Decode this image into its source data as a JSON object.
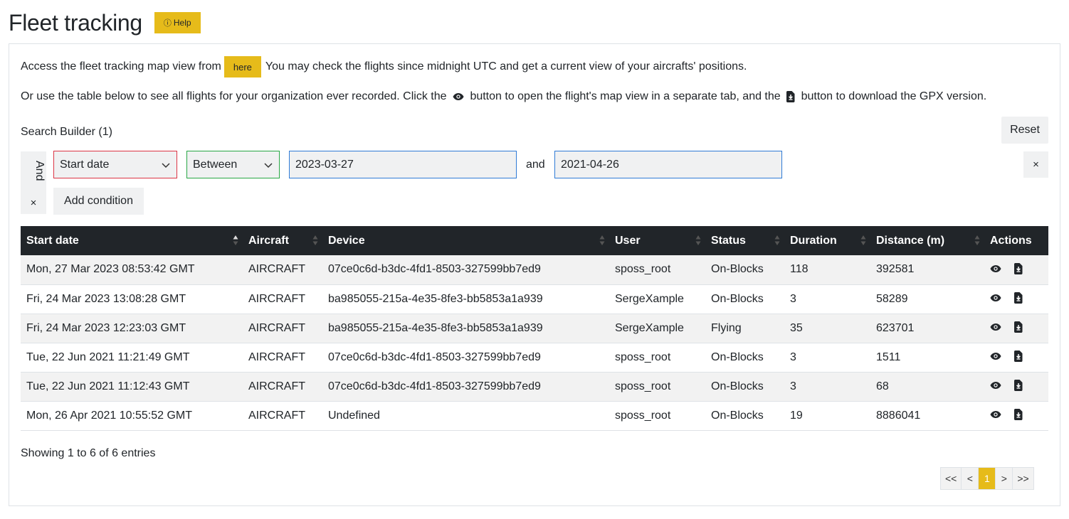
{
  "header": {
    "title": "Fleet tracking",
    "help_label": "Help"
  },
  "intro": {
    "line1_before": "Access the fleet tracking map view from",
    "here_label": "here",
    "line1_after": "You may check the flights since midnight UTC and get a current view of your aircrafts' positions.",
    "line2_a": "Or use the table below to see all flights for your organization ever recorded. Click the",
    "line2_b": "button to open the flight's map view in a separate tab, and the",
    "line2_c": "button to download the GPX version."
  },
  "search_builder": {
    "title": "Search Builder (1)",
    "reset_label": "Reset",
    "logic": "And",
    "remove_glyph": "×",
    "field": "Start date",
    "condition": "Between",
    "value1": "2023-03-27",
    "joiner": "and",
    "value2": "2021-04-26",
    "add_condition_label": "Add condition"
  },
  "table": {
    "columns": [
      "Start date",
      "Aircraft",
      "Device",
      "User",
      "Status",
      "Duration",
      "Distance (m)",
      "Actions"
    ],
    "rows": [
      {
        "start_date": "Mon, 27 Mar 2023 08:53:42 GMT",
        "aircraft": "AIRCRAFT",
        "device": "07ce0c6d-b3dc-4fd1-8503-327599bb7ed9",
        "user": "sposs_root",
        "status": "On-Blocks",
        "duration": "118",
        "distance": "392581"
      },
      {
        "start_date": "Fri, 24 Mar 2023 13:08:28 GMT",
        "aircraft": "AIRCRAFT",
        "device": "ba985055-215a-4e35-8fe3-bb5853a1a939",
        "user": "SergeXample",
        "status": "On-Blocks",
        "duration": "3",
        "distance": "58289"
      },
      {
        "start_date": "Fri, 24 Mar 2023 12:23:03 GMT",
        "aircraft": "AIRCRAFT",
        "device": "ba985055-215a-4e35-8fe3-bb5853a1a939",
        "user": "SergeXample",
        "status": "Flying",
        "duration": "35",
        "distance": "623701"
      },
      {
        "start_date": "Tue, 22 Jun 2021 11:21:49 GMT",
        "aircraft": "AIRCRAFT",
        "device": "07ce0c6d-b3dc-4fd1-8503-327599bb7ed9",
        "user": "sposs_root",
        "status": "On-Blocks",
        "duration": "3",
        "distance": "1511"
      },
      {
        "start_date": "Tue, 22 Jun 2021 11:12:43 GMT",
        "aircraft": "AIRCRAFT",
        "device": "07ce0c6d-b3dc-4fd1-8503-327599bb7ed9",
        "user": "sposs_root",
        "status": "On-Blocks",
        "duration": "3",
        "distance": "68"
      },
      {
        "start_date": "Mon, 26 Apr 2021 10:55:52 GMT",
        "aircraft": "AIRCRAFT",
        "device": "Undefined",
        "user": "sposs_root",
        "status": "On-Blocks",
        "duration": "19",
        "distance": "8886041"
      }
    ]
  },
  "footer": {
    "info": "Showing 1 to 6 of 6 entries",
    "pagination": {
      "first": "<<",
      "prev": "<",
      "current": "1",
      "next": ">",
      "last": ">>"
    }
  },
  "colors": {
    "accent": "#e6bb1a",
    "header_bg": "#212529",
    "field_border": "#dc3545",
    "condition_border": "#28a745",
    "value_border": "#2f7bd6"
  },
  "icons": {
    "view": "eye-icon",
    "download": "file-download-icon",
    "info": "info-circle-icon"
  }
}
